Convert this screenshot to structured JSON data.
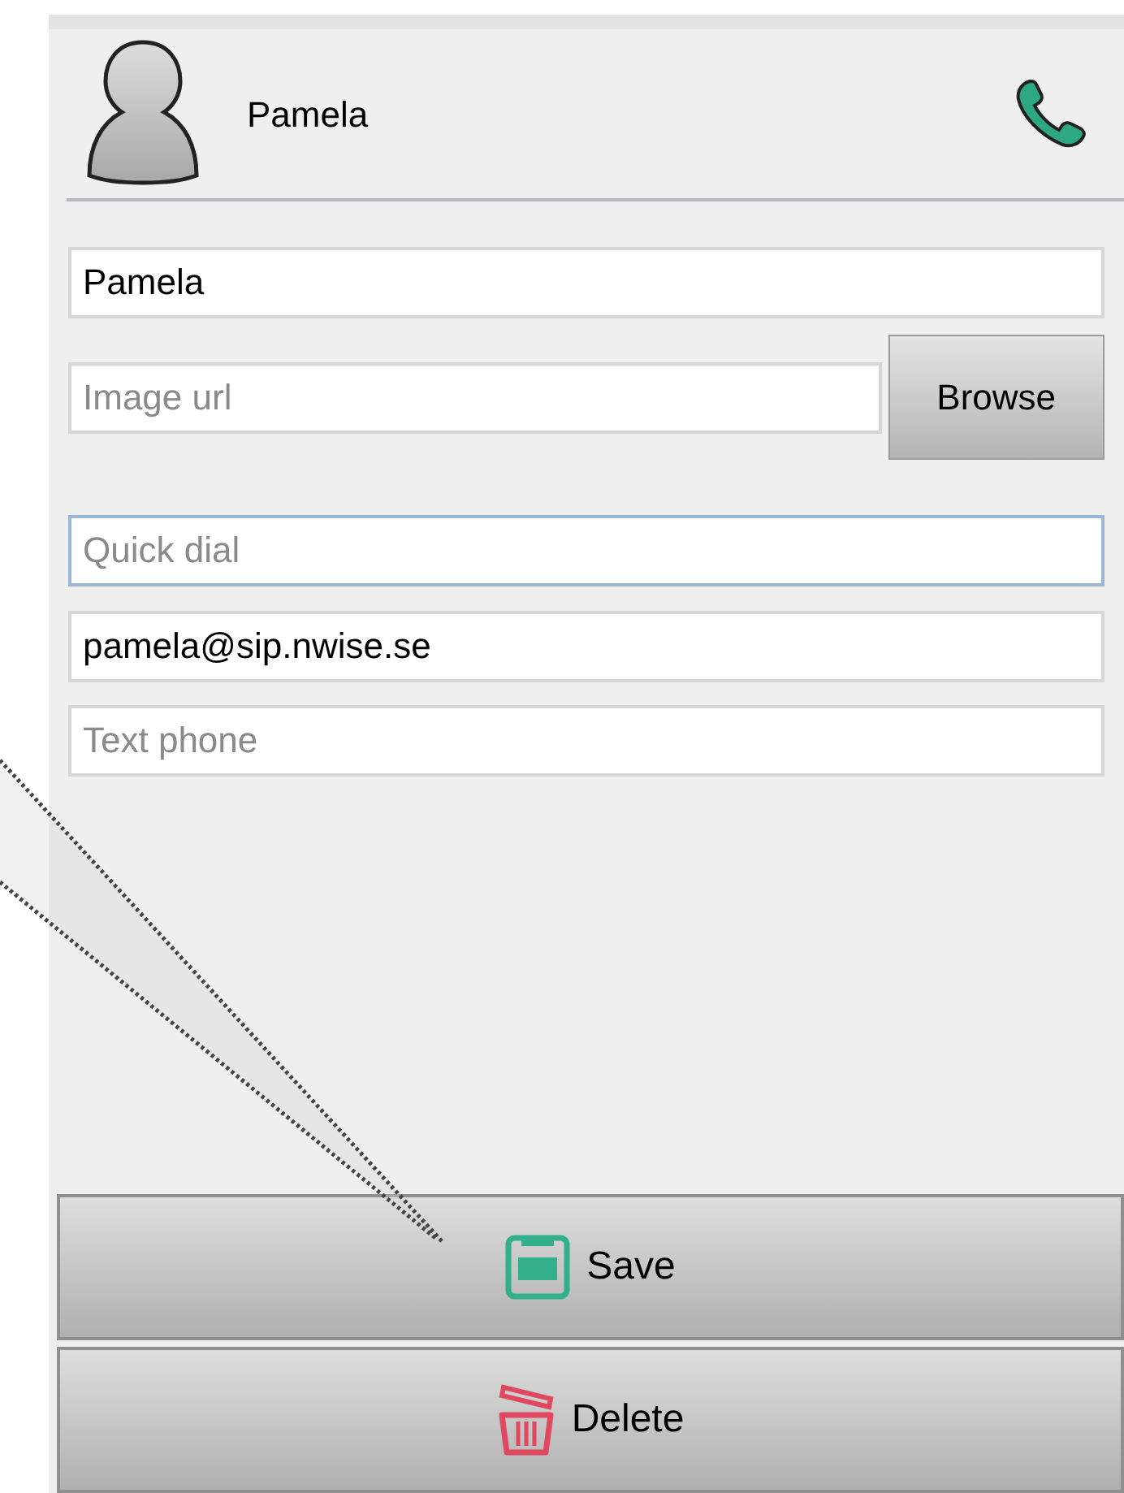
{
  "contact": {
    "name": "Pamela"
  },
  "fields": [
    {
      "kind": "text",
      "value": "Pamela",
      "focused": false
    },
    {
      "kind": "browse",
      "placeholder": "Image url",
      "button": "Browse",
      "focused": false
    },
    {
      "kind": "text",
      "placeholder": "Quick dial",
      "focused": true
    },
    {
      "kind": "text",
      "value": "pamela@sip.nwise.se",
      "focused": false
    },
    {
      "kind": "text",
      "placeholder": "Text phone",
      "focused": false
    }
  ],
  "buttons": [
    {
      "kind": "save",
      "label": "Save"
    },
    {
      "kind": "delete",
      "label": "Delete"
    }
  ]
}
